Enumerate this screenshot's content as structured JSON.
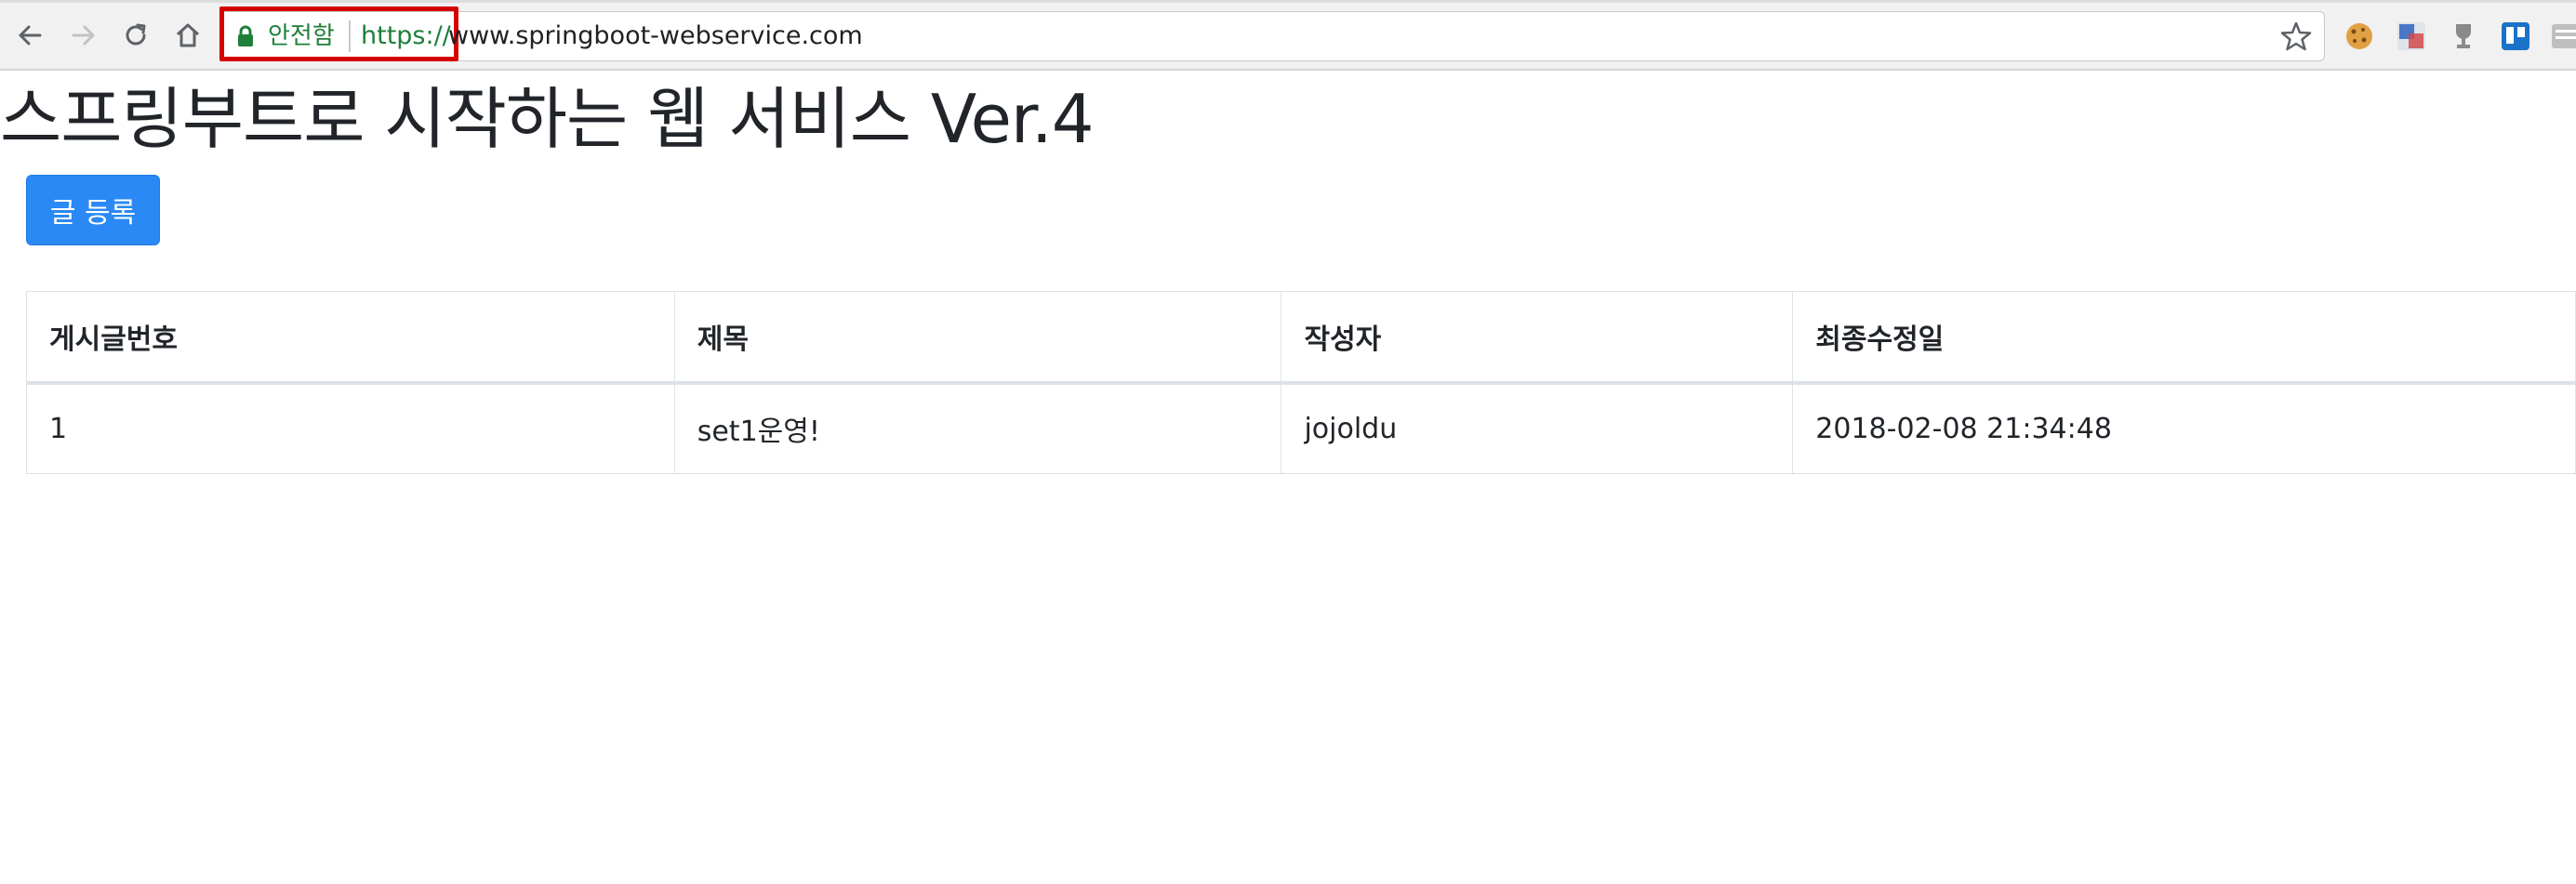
{
  "browser": {
    "security_label": "안전함",
    "url_scheme": "https://",
    "url_host": "www.springboot-webservice.com",
    "icons": [
      "back-icon",
      "forward-icon",
      "reload-icon",
      "home-icon",
      "lock-icon",
      "bookmark-star-icon",
      "cookie-extension-icon",
      "translate-extension-icon",
      "trophy-extension-icon",
      "trello-extension-icon",
      "extension-icon"
    ],
    "colors": {
      "secure_green": "#1e7f3a",
      "highlight_red": "#d40000"
    }
  },
  "page": {
    "title": "스프링부트로 시작하는 웹 서비스 Ver.4",
    "register_button": "글 등록",
    "primary_color": "#2b89f5"
  },
  "table": {
    "columns": [
      "게시글번호",
      "제목",
      "작성자",
      "최종수정일"
    ],
    "rows": [
      [
        "1",
        "set1운영!",
        "jojoldu",
        "2018-02-08 21:34:48"
      ]
    ]
  }
}
